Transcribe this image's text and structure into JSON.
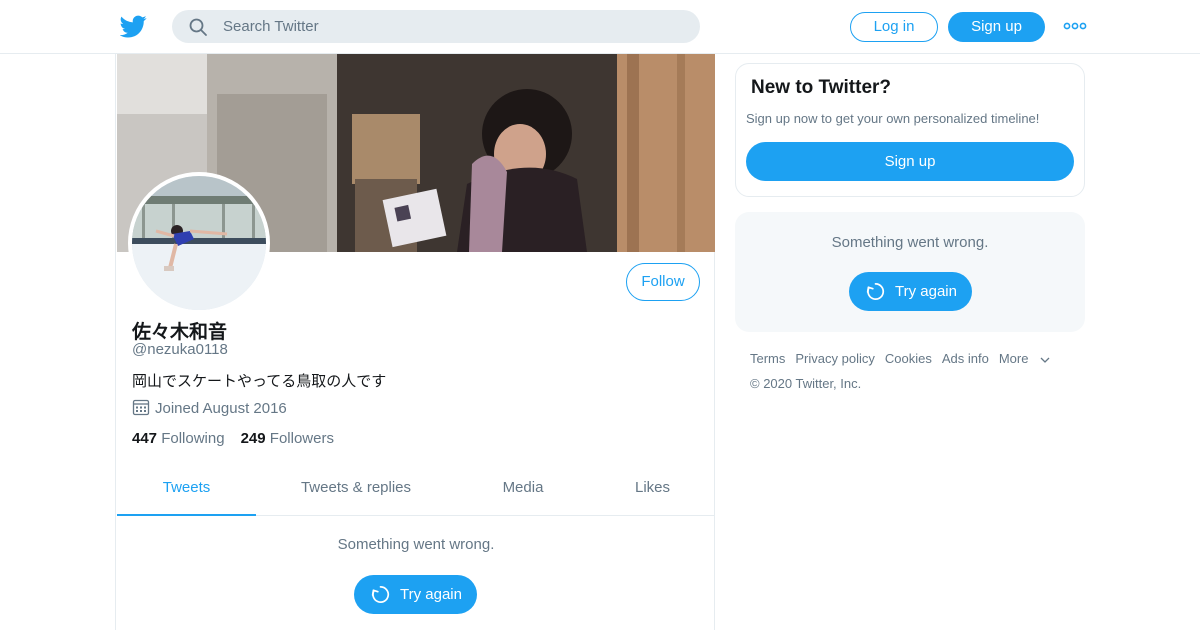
{
  "header": {
    "search_placeholder": "Search Twitter",
    "login_label": "Log in",
    "signup_label": "Sign up",
    "brand_color": "#1da1f2"
  },
  "profile": {
    "name": "佐々木和音",
    "handle": "@nezuka0118",
    "bio": "岡山でスケートやってる鳥取の人です",
    "joined": "Joined August 2016",
    "following_count": "447",
    "following_label": "Following",
    "followers_count": "249",
    "followers_label": "Followers",
    "follow_label": "Follow"
  },
  "tabs": [
    {
      "label": "Tweets",
      "active": true
    },
    {
      "label": "Tweets & replies",
      "active": false
    },
    {
      "label": "Media",
      "active": false
    },
    {
      "label": "Likes",
      "active": false
    }
  ],
  "timeline": {
    "error_message": "Something went wrong.",
    "retry_label": "Try again"
  },
  "sidebar": {
    "new_title": "New to Twitter?",
    "new_subtitle": "Sign up now to get your own personalized timeline!",
    "signup_label": "Sign up",
    "error_message": "Something went wrong.",
    "retry_label": "Try again"
  },
  "footer": {
    "links": [
      "Terms",
      "Privacy policy",
      "Cookies",
      "Ads info",
      "More"
    ],
    "copyright": "© 2020 Twitter, Inc."
  }
}
